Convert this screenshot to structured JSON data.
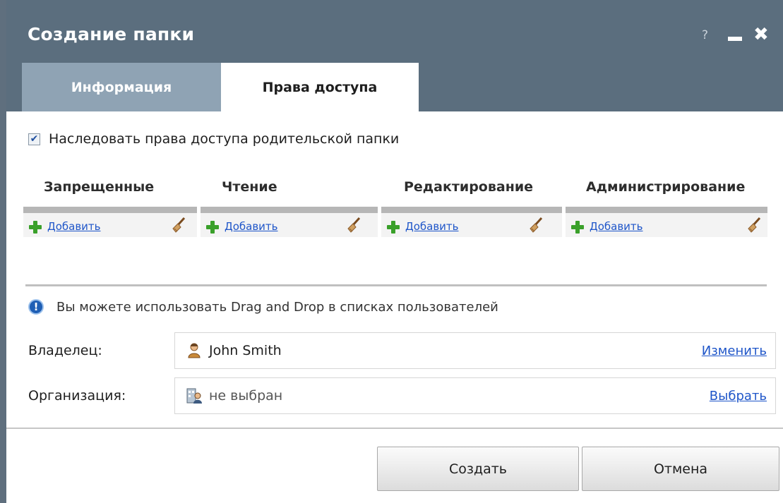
{
  "dialog": {
    "title": "Создание папки",
    "controls": {
      "help": "?",
      "close": "✖"
    }
  },
  "tabs": [
    {
      "label": "Информация",
      "active": false
    },
    {
      "label": "Права доступа",
      "active": true
    }
  ],
  "inherit": {
    "label": "Наследовать права доступа родительской папки",
    "checked": true
  },
  "columns": [
    {
      "header": "Запрещенные",
      "add_label": "Добавить"
    },
    {
      "header": "Чтение",
      "add_label": "Добавить"
    },
    {
      "header": "Редактирование",
      "add_label": "Добавить"
    },
    {
      "header": "Администрирование",
      "add_label": "Добавить"
    }
  ],
  "info": {
    "text": "Вы можете использовать Drag and Drop в списках пользователей",
    "icon": "info-icon"
  },
  "owner": {
    "label": "Владелец:",
    "value": "John Smith",
    "action": "Изменить",
    "icon": "user-icon"
  },
  "organization": {
    "label": "Организация:",
    "value": "не выбран",
    "action": "Выбрать",
    "icon": "organization-icon"
  },
  "buttons": {
    "create": "Создать",
    "cancel": "Отмена"
  },
  "colors": {
    "header": "#5b6e7e",
    "inactive_tab": "#8fa3b4",
    "link": "#1f56c9",
    "add_icon": "#3aa02a"
  }
}
